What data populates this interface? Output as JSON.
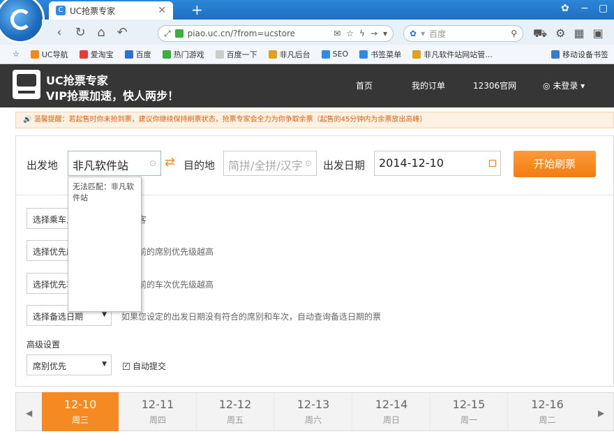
{
  "browser": {
    "tab_title": "UC抢票专家",
    "url": "piao.uc.cn/?from=ucstore",
    "search_placeholder": "百度",
    "bookmarks": [
      {
        "label": "UC导航",
        "color": "#f08a1a"
      },
      {
        "label": "爱淘宝",
        "color": "#e83c3c"
      },
      {
        "label": "百度",
        "color": "#2f6fd8"
      },
      {
        "label": "热门游戏",
        "color": "#3ab03a"
      },
      {
        "label": "百度一下",
        "color": "#cccccc"
      },
      {
        "label": "非凡后台",
        "color": "#e0a020"
      },
      {
        "label": "SEO",
        "color": "#2f8be6"
      },
      {
        "label": "书签菜单",
        "color": "#2f8be6"
      },
      {
        "label": "非凡软件站网站管...",
        "color": "#e0a020"
      }
    ],
    "bookmark_right": "移动设备书签"
  },
  "site": {
    "title": "UC抢票专家",
    "subtitle": "VIP抢票加速，快人两步！",
    "nav": [
      "首页",
      "我的订单",
      "12306官网"
    ],
    "login": "未登录"
  },
  "notice": "温馨提醒：若起售时你未抢到票，建议你继续保持刷票状态，抢票专家会全力为你争取余票（起售的45分钟内为余票放出高峰）",
  "form": {
    "from_label": "出发地",
    "from_value": "非凡软件站",
    "to_label": "目的地",
    "to_placeholder": "简拼/全拼/汉字",
    "date_label": "出发日期",
    "date_value": "2014-12-10",
    "start_button": "开始刷票",
    "dropdown_text": "无法匹配：非凡软件站",
    "options": [
      {
        "select": "选择乘车人",
        "hint": "择乘客"
      },
      {
        "select": "选择优先席别",
        "hint": "越靠前的席别优先级越高"
      },
      {
        "select": "选择优先车次",
        "hint": "越靠前的车次优先级越高"
      },
      {
        "select": "选择备选日期",
        "hint": "如果您设定的出发日期没有符合的席别和车次，自动查询备选日期的票"
      }
    ],
    "advanced_label": "高级设置",
    "advanced_select": "席别优先",
    "auto_submit": "自动提交"
  },
  "dates": [
    {
      "date": "12-10",
      "week": "周三",
      "active": true
    },
    {
      "date": "12-11",
      "week": "周四"
    },
    {
      "date": "12-12",
      "week": "周五"
    },
    {
      "date": "12-13",
      "week": "周六"
    },
    {
      "date": "12-14",
      "week": "周日"
    },
    {
      "date": "12-15",
      "week": "周一"
    },
    {
      "date": "12-16",
      "week": "周二"
    }
  ]
}
